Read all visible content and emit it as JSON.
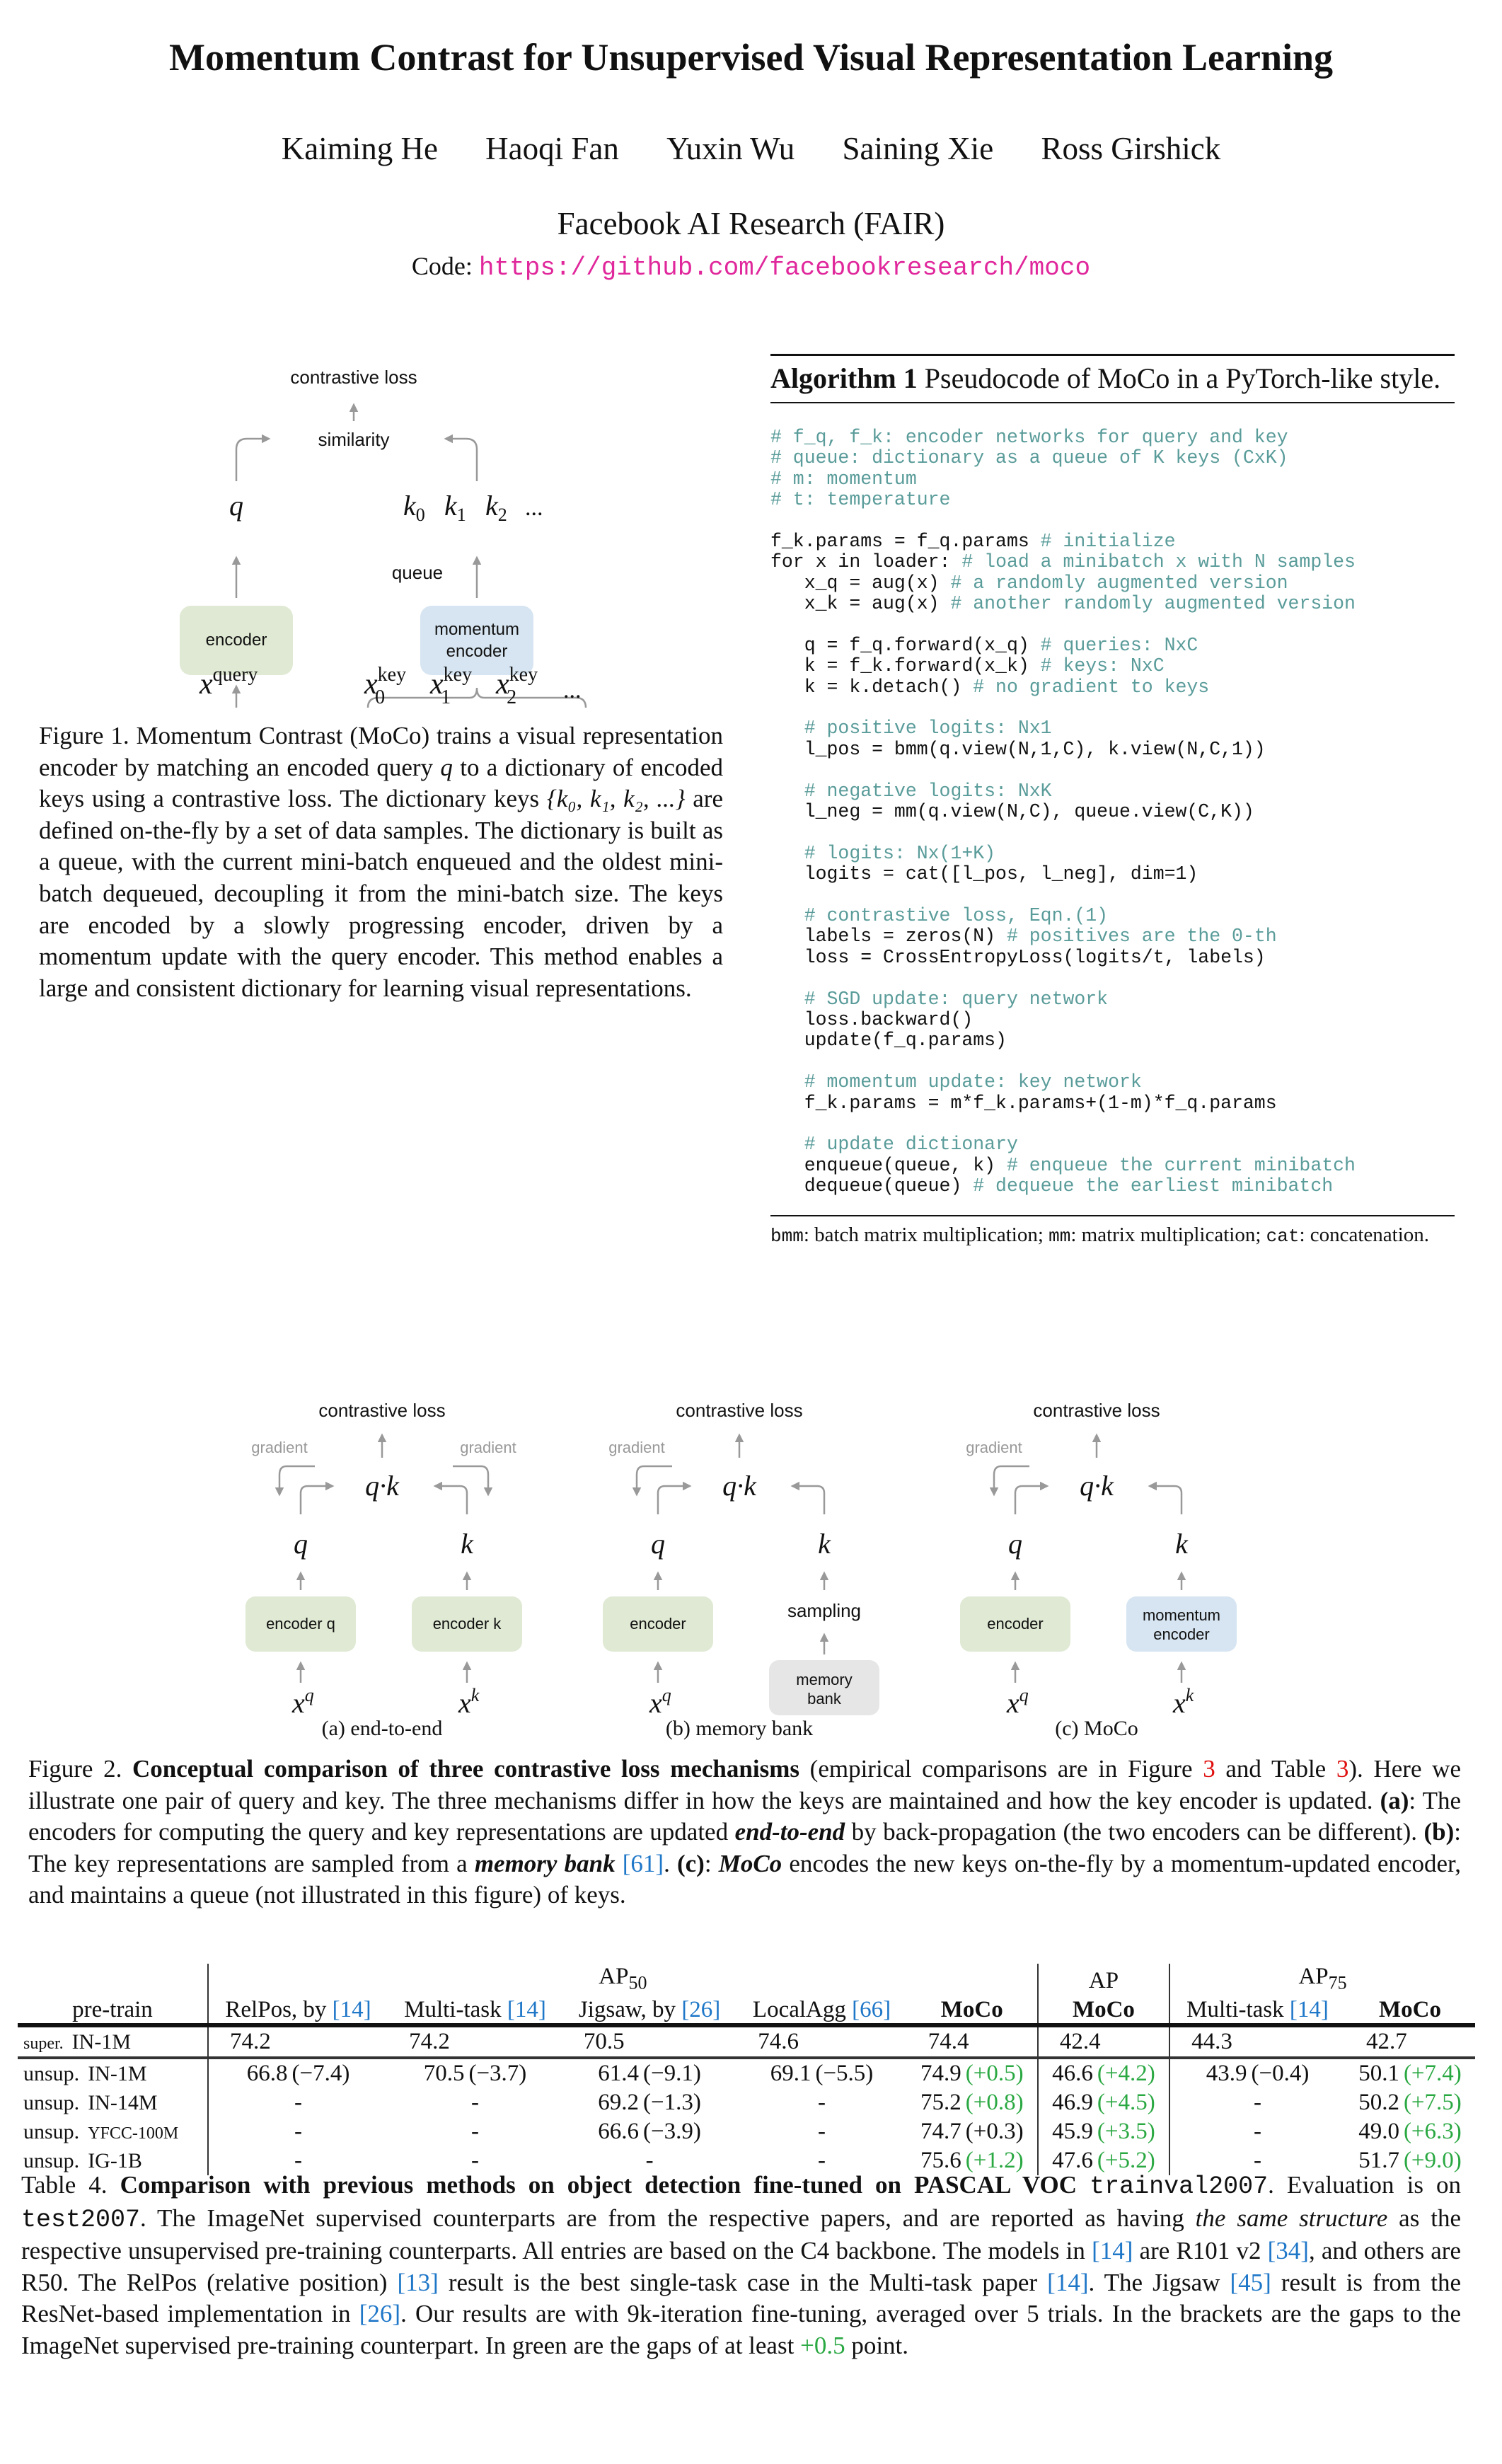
{
  "paper": {
    "title": "Momentum Contrast for Unsupervised Visual Representation Learning",
    "authors": [
      "Kaiming He",
      "Haoqi Fan",
      "Yuxin Wu",
      "Saining Xie",
      "Ross Girshick"
    ],
    "affiliation": "Facebook AI Research (FAIR)",
    "code_label": "Code:",
    "code_url": "https://github.com/facebookresearch/moco"
  },
  "colors": {
    "url": "#e0289c",
    "ref": "#1f77c8",
    "fig_ref": "#e01010",
    "gain": "#2aa842",
    "code_comment": "#5a9c9a",
    "encoder_box": "#dfe9d3",
    "momentum_box": "#d6e5f1",
    "memory_box": "#e6e6e6",
    "arrow": "#999999"
  },
  "figure1": {
    "contrastive_loss": "contrastive loss",
    "similarity": "similarity",
    "q": "q",
    "keys": [
      "k0",
      "k1",
      "k2",
      "..."
    ],
    "queue": "queue",
    "encoder": "encoder",
    "momentum_encoder_1": "momentum",
    "momentum_encoder_2": "encoder",
    "x_query": "x",
    "x_query_sup": "query",
    "x_key_sup": "key",
    "x_key_subs": [
      "0",
      "1",
      "2"
    ],
    "ellipsis": "...",
    "caption": "Figure 1. Momentum Contrast (MoCo) trains a visual representation encoder by matching an encoded query q to a dictionary of encoded keys using a contrastive loss. The dictionary keys {k0, k1, k2, ...} are defined on-the-fly by a set of data samples. The dictionary is built as a queue, with the current mini-batch enqueued and the oldest mini-batch dequeued, decoupling it from the mini-batch size. The keys are encoded by a slowly progressing encoder, driven by a momentum update with the query encoder. This method enables a large and consistent dictionary for learning visual representations.",
    "caption_parts": {
      "p1": "Figure 1. Momentum Contrast (MoCo) trains a visual representation encoder by matching an encoded query ",
      "q": "q",
      "p2": " to a dictionary of encoded keys using a contrastive loss. The dictionary keys ",
      "set": "{k₀, k₁, k₂, ...}",
      "p3": " are defined on-the-fly by a set of data samples. The dictionary is built as a queue, with the current mini-batch enqueued and the oldest mini-batch dequeued, decoupling it from the mini-batch size. The keys are encoded by a slowly progressing encoder, driven by a momentum update with the query encoder. This method enables a large and consistent dictionary for learning visual representations."
    }
  },
  "algorithm": {
    "label": "Algorithm 1",
    "title": "Pseudocode of MoCo in a PyTorch-like style.",
    "lines": [
      {
        "code": "",
        "comment": "# f_q, f_k: encoder networks for query and key"
      },
      {
        "code": "",
        "comment": "# queue: dictionary as a queue of K keys (CxK)"
      },
      {
        "code": "",
        "comment": "# m: momentum"
      },
      {
        "code": "",
        "comment": "# t: temperature"
      },
      {
        "code": "",
        "comment": ""
      },
      {
        "code": "f_k.params = f_q.params ",
        "comment": "# initialize"
      },
      {
        "code": "for x in loader: ",
        "comment": "# load a minibatch x with N samples"
      },
      {
        "code": "   x_q = aug(x) ",
        "comment": "# a randomly augmented version"
      },
      {
        "code": "   x_k = aug(x) ",
        "comment": "# another randomly augmented version"
      },
      {
        "code": "",
        "comment": ""
      },
      {
        "code": "   q = f_q.forward(x_q) ",
        "comment": "# queries: NxC"
      },
      {
        "code": "   k = f_k.forward(x_k) ",
        "comment": "# keys: NxC"
      },
      {
        "code": "   k = k.detach() ",
        "comment": "# no gradient to keys"
      },
      {
        "code": "",
        "comment": ""
      },
      {
        "code": "   ",
        "comment": "# positive logits: Nx1"
      },
      {
        "code": "   l_pos = bmm(q.view(N,1,C), k.view(N,C,1))",
        "comment": ""
      },
      {
        "code": "",
        "comment": ""
      },
      {
        "code": "   ",
        "comment": "# negative logits: NxK"
      },
      {
        "code": "   l_neg = mm(q.view(N,C), queue.view(C,K))",
        "comment": ""
      },
      {
        "code": "",
        "comment": ""
      },
      {
        "code": "   ",
        "comment": "# logits: Nx(1+K)"
      },
      {
        "code": "   logits = cat([l_pos, l_neg], dim=1)",
        "comment": ""
      },
      {
        "code": "",
        "comment": ""
      },
      {
        "code": "   ",
        "comment": "# contrastive loss, Eqn.(1)"
      },
      {
        "code": "   labels = zeros(N) ",
        "comment": "# positives are the 0-th"
      },
      {
        "code": "   loss = CrossEntropyLoss(logits/t, labels)",
        "comment": ""
      },
      {
        "code": "",
        "comment": ""
      },
      {
        "code": "   ",
        "comment": "# SGD update: query network"
      },
      {
        "code": "   loss.backward()",
        "comment": ""
      },
      {
        "code": "   update(f_q.params)",
        "comment": ""
      },
      {
        "code": "",
        "comment": ""
      },
      {
        "code": "   ",
        "comment": "# momentum update: key network"
      },
      {
        "code": "   f_k.params = m*f_k.params+(1-m)*f_q.params",
        "comment": ""
      },
      {
        "code": "",
        "comment": ""
      },
      {
        "code": "   ",
        "comment": "# update dictionary"
      },
      {
        "code": "   enqueue(queue, k) ",
        "comment": "# enqueue the current minibatch"
      },
      {
        "code": "   dequeue(queue) ",
        "comment": "# dequeue the earliest minibatch"
      }
    ],
    "footnote": [
      {
        "mono": "bmm",
        "text": ": batch matrix multiplication; "
      },
      {
        "mono": "mm",
        "text": ": matrix multiplication; "
      },
      {
        "mono": "cat",
        "text": ": concatenation."
      }
    ]
  },
  "figure2": {
    "panels": [
      {
        "label": "(a) end-to-end",
        "contrastive_loss": "contrastive loss",
        "gradient_left": "gradient",
        "gradient_right": "gradient",
        "qk": "q·k",
        "q": "q",
        "k": "k",
        "left_box": "encoder q",
        "right_box_lines": [
          "encoder k"
        ],
        "right_box_type": "encoder",
        "xq_base": "x",
        "xq_sup": "q",
        "xk_base": "x",
        "xk_sup": "k"
      },
      {
        "label": "(b) memory bank",
        "contrastive_loss": "contrastive loss",
        "gradient_left": "gradient",
        "qk": "q·k",
        "q": "q",
        "k": "k",
        "left_box": "encoder",
        "sampling": "sampling",
        "right_box_lines": [
          "memory",
          "bank"
        ],
        "right_box_type": "memory",
        "xq_base": "x",
        "xq_sup": "q"
      },
      {
        "label": "(c) MoCo",
        "contrastive_loss": "contrastive loss",
        "gradient_left": "gradient",
        "qk": "q·k",
        "q": "q",
        "k": "k",
        "left_box": "encoder",
        "right_box_lines": [
          "momentum",
          "encoder"
        ],
        "right_box_type": "momentum",
        "xq_base": "x",
        "xq_sup": "q",
        "xk_base": "x",
        "xk_sup": "k"
      }
    ],
    "caption": {
      "prefix": "Figure 2. ",
      "bold": "Conceptual comparison of three contrastive loss mechanisms",
      "t1": " (empirical comparisons are in Figure ",
      "fig_ref": "3",
      "t2": " and Table ",
      "tab_ref": "3",
      "t3": "). Here we illustrate one pair of query and key. The three mechanisms differ in how the keys are maintained and how the key encoder is updated. ",
      "a_label": "(a)",
      "a_text1": ": The encoders for computing the query and key representations are updated ",
      "a_em": "end-to-end",
      "a_text2": " by back-propagation (the two encoders can be different). ",
      "b_label": "(b)",
      "b_text1": ": The key representations are sampled from a ",
      "b_em": "memory bank",
      "b_ref": "[61]",
      "b_text2": ". ",
      "c_label": "(c)",
      "c_text1": ": ",
      "c_em": "MoCo",
      "c_text2": " encodes the new keys on-the-fly by a momentum-updated encoder, and maintains a queue (not illustrated in this figure) of keys."
    }
  },
  "table4": {
    "group_headers": {
      "ap50": "AP",
      "ap50_sub": "50",
      "ap": "AP",
      "ap75": "AP",
      "ap75_sub": "75"
    },
    "columns": [
      {
        "label": "pre-train"
      },
      {
        "label": "RelPos, by ",
        "ref": "[14]"
      },
      {
        "label": "Multi-task ",
        "ref": "[14]"
      },
      {
        "label": "Jigsaw, by ",
        "ref": "[26]"
      },
      {
        "label": "LocalAgg ",
        "ref": "[66]"
      },
      {
        "label": "MoCo",
        "bold": true
      },
      {
        "label": "MoCo",
        "bold": true
      },
      {
        "label": "Multi-task ",
        "ref": "[14]"
      },
      {
        "label": "MoCo",
        "bold": true
      }
    ],
    "rows": [
      {
        "kind": "super.",
        "data": "IN-1M",
        "small": false,
        "cells": [
          [
            "74.2",
            ""
          ],
          [
            "74.2",
            ""
          ],
          [
            "70.5",
            ""
          ],
          [
            "74.6",
            ""
          ],
          [
            "74.4",
            ""
          ],
          [
            "42.4",
            ""
          ],
          [
            "44.3",
            ""
          ],
          [
            "42.7",
            ""
          ]
        ],
        "green": [
          false,
          false,
          false,
          false,
          false,
          false,
          false,
          false
        ]
      },
      {
        "kind": "unsup.",
        "data": "IN-1M",
        "small": false,
        "cells": [
          [
            "66.8",
            "(−7.4)"
          ],
          [
            "70.5",
            "(−3.7)"
          ],
          [
            "61.4",
            "(−9.1)"
          ],
          [
            "69.1",
            "(−5.5)"
          ],
          [
            "74.9",
            "(+0.5)"
          ],
          [
            "46.6",
            "(+4.2)"
          ],
          [
            "43.9",
            "(−0.4)"
          ],
          [
            "50.1",
            "(+7.4)"
          ]
        ],
        "green": [
          false,
          false,
          false,
          false,
          true,
          true,
          false,
          true
        ]
      },
      {
        "kind": "unsup.",
        "data": "IN-14M",
        "small": false,
        "cells": [
          [
            "-",
            ""
          ],
          [
            "-",
            ""
          ],
          [
            "69.2",
            "(−1.3)"
          ],
          [
            "-",
            ""
          ],
          [
            "75.2",
            "(+0.8)"
          ],
          [
            "46.9",
            "(+4.5)"
          ],
          [
            "-",
            ""
          ],
          [
            "50.2",
            "(+7.5)"
          ]
        ],
        "green": [
          false,
          false,
          false,
          false,
          true,
          true,
          false,
          true
        ]
      },
      {
        "kind": "unsup.",
        "data": "YFCC-100M",
        "small": true,
        "cells": [
          [
            "-",
            ""
          ],
          [
            "-",
            ""
          ],
          [
            "66.6",
            "(−3.9)"
          ],
          [
            "-",
            ""
          ],
          [
            "74.7",
            "(+0.3)"
          ],
          [
            "45.9",
            "(+3.5)"
          ],
          [
            "-",
            ""
          ],
          [
            "49.0",
            "(+6.3)"
          ]
        ],
        "green": [
          false,
          false,
          false,
          false,
          false,
          true,
          false,
          true
        ]
      },
      {
        "kind": "unsup.",
        "data": "IG-1B",
        "small": false,
        "cells": [
          [
            "-",
            ""
          ],
          [
            "-",
            ""
          ],
          [
            "-",
            ""
          ],
          [
            "-",
            ""
          ],
          [
            "75.6",
            "(+1.2)"
          ],
          [
            "47.6",
            "(+5.2)"
          ],
          [
            "-",
            ""
          ],
          [
            "51.7",
            "(+9.0)"
          ]
        ],
        "green": [
          false,
          false,
          false,
          false,
          true,
          true,
          false,
          true
        ]
      }
    ],
    "caption": {
      "prefix": "Table 4.  ",
      "bold": "Comparison with previous methods on object detection fine-tuned on PASCAL VOC ",
      "mono1": "trainval2007",
      "t1": ". Evaluation is on ",
      "mono2": "test2007",
      "t2": ". The ImageNet supervised counterparts are from the respective papers, and are reported as having ",
      "em": "the same structure",
      "t3": " as the respective unsupervised pre-training counterparts. All entries are based on the C4 backbone. The models in ",
      "r14a": "[14]",
      "t4": " are R101 v2 ",
      "r34": "[34]",
      "t5": ", and others are R50. The RelPos (relative position) ",
      "r13": "[13]",
      "t6": " result is the best single-task case in the Multi-task paper ",
      "r14b": "[14]",
      "t7": ". The Jigsaw ",
      "r45": "[45]",
      "t8": " result is from the ResNet-based implementation in ",
      "r26": "[26]",
      "t9": ". Our results are with 9k-iteration fine-tuning, averaged over 5 trials. In the brackets are the gaps to the ImageNet supervised pre-training counterpart. In green are the gaps of at least ",
      "green_val": "+0.5",
      "t10": " point."
    }
  }
}
